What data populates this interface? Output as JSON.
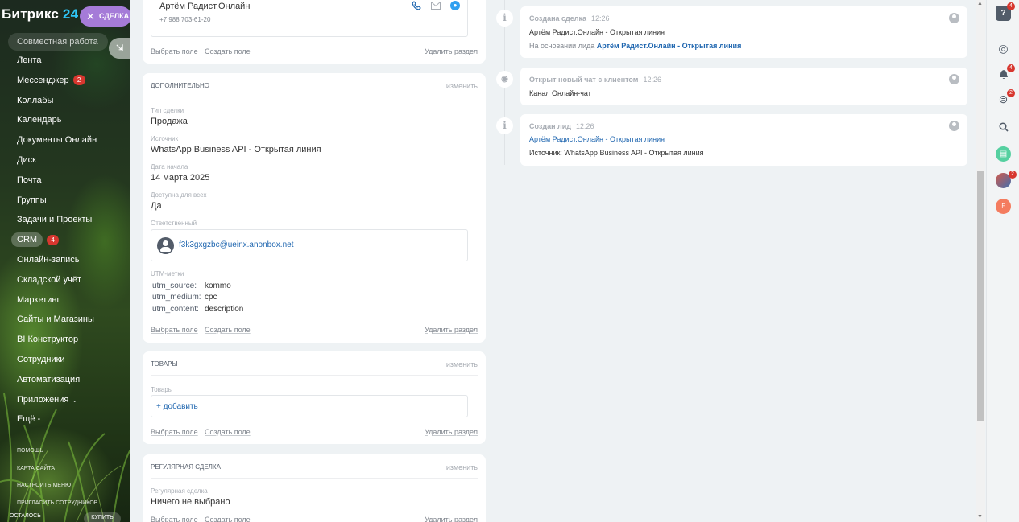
{
  "sidebar": {
    "logo_text": "Битрикс",
    "logo_num": "24",
    "deal_pill": "СДЕЛКА",
    "group_title": "Совместная работа",
    "items": [
      {
        "label": "Лента",
        "badge": ""
      },
      {
        "label": "Мессенджер",
        "badge": "2"
      },
      {
        "label": "Коллабы",
        "badge": ""
      },
      {
        "label": "Календарь",
        "badge": ""
      },
      {
        "label": "Документы Онлайн",
        "badge": ""
      },
      {
        "label": "Диск",
        "badge": ""
      },
      {
        "label": "Почта",
        "badge": ""
      },
      {
        "label": "Группы",
        "badge": ""
      },
      {
        "label": "Задачи и Проекты",
        "badge": ""
      },
      {
        "label": "CRM",
        "badge": "4"
      },
      {
        "label": "Онлайн-запись",
        "badge": ""
      },
      {
        "label": "Складской учёт",
        "badge": ""
      },
      {
        "label": "Маркетинг",
        "badge": ""
      },
      {
        "label": "Сайты и Магазины",
        "badge": ""
      },
      {
        "label": "BI Конструктор",
        "badge": ""
      },
      {
        "label": "Сотрудники",
        "badge": ""
      },
      {
        "label": "Автоматизация",
        "badge": ""
      },
      {
        "label": "Приложения",
        "badge": ""
      },
      {
        "label": "Ещё -",
        "badge": ""
      }
    ],
    "footer": [
      "ПОМОЩЬ",
      "КАРТА САЙТА",
      "НАСТРОИТЬ МЕНЮ",
      "ПРИГЛАСИТЬ СОТРУДНИКОВ"
    ],
    "bottom_left": "ОСТАЛОСЬ",
    "buy_label": "КУПИТЬ"
  },
  "contact_card": {
    "name": "Артём Радист.Онлайн",
    "phone": "+7 988 703-61-20",
    "actions": {
      "choose": "Выбрать поле",
      "create": "Создать поле",
      "delete": "Удалить раздел"
    }
  },
  "additional": {
    "title": "ДОПОЛНИТЕЛЬНО",
    "edit": "изменить",
    "fields": {
      "deal_type_label": "Тип сделки",
      "deal_type": "Продажа",
      "source_label": "Источник",
      "source": "WhatsApp Business API - Открытая линия",
      "start_label": "Дата начала",
      "start": "14 марта 2025",
      "available_label": "Доступна для всех",
      "available": "Да",
      "responsible_label": "Ответственный",
      "responsible": "f3k3gxgzbc@ueinx.anonbox.net",
      "utm_label": "UTM-метки"
    },
    "utm": [
      {
        "key": "utm_source:",
        "value": "kommo"
      },
      {
        "key": "utm_medium:",
        "value": "cpc"
      },
      {
        "key": "utm_content:",
        "value": "description"
      }
    ],
    "actions": {
      "choose": "Выбрать поле",
      "create": "Создать поле",
      "delete": "Удалить раздел"
    }
  },
  "products": {
    "title": "ТОВАРЫ",
    "edit": "изменить",
    "label": "Товары",
    "add": "+ добавить",
    "actions": {
      "choose": "Выбрать поле",
      "create": "Создать поле",
      "delete": "Удалить раздел"
    }
  },
  "regular": {
    "title": "РЕГУЛЯРНАЯ СДЕЛКА",
    "edit": "изменить",
    "label": "Регулярная сделка",
    "value": "Ничего не выбрано",
    "actions": {
      "choose": "Выбрать поле",
      "create": "Создать поле",
      "delete": "Удалить раздел"
    }
  },
  "timeline": [
    {
      "title": "Создана сделка",
      "time": "12:26",
      "line1": "Артём Радист.Онлайн - Открытая линия",
      "line2_prefix": "На основании лида",
      "line2_link": "Артём Радист.Онлайн - Открытая линия"
    },
    {
      "title": "Открыт новый чат с клиентом",
      "time": "12:26",
      "line1": "Канал Онлайн-чат"
    },
    {
      "title": "Создан лид",
      "time": "12:26",
      "line1": "Артём Радист.Онлайн - Открытая линия",
      "line2": "Источник: WhatsApp Business API - Открытая линия"
    }
  ],
  "right_panel": {
    "help_badge": "4",
    "notif_badge": "4",
    "chat_badge": "2",
    "avatar_badge": "2",
    "user_initial": "F"
  },
  "colors": {
    "accent": "#2067b0",
    "deal_pill": "#a57bd8",
    "badge": "#d7372f"
  }
}
